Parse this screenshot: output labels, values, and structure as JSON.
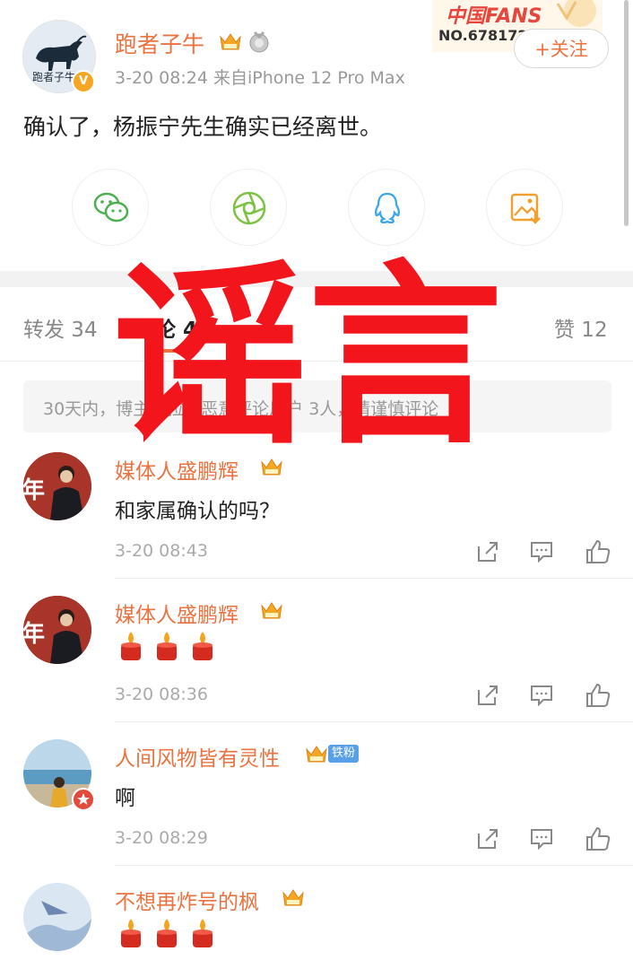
{
  "post": {
    "author": "跑者子牛",
    "avatar_text": "跑者子牛",
    "verified_badge": "V",
    "time_source": "3-20 08:24  来自iPhone 12 Pro Max",
    "text": "确认了，杨振宁先生确实已经离世。",
    "fans_badge_title": "中国FANS",
    "fans_badge_no": "NO.678172",
    "follow_label": "+关注"
  },
  "share_icons": [
    "wechat-icon",
    "moments-icon",
    "qq-icon",
    "save-image-icon"
  ],
  "tabs": {
    "repost": "转发 34",
    "comments": "评论 49",
    "likes": "赞 12"
  },
  "notice": "30天内，博主已拉黑恶意评论用户 3人，请谨慎评论",
  "overlay_text": "谣言",
  "comments": [
    {
      "name": "媒体人盛鹏辉",
      "avatar_text": "年",
      "text": "和家属确认的吗？",
      "time": "3-20 08:43",
      "candles": 0,
      "badge": ""
    },
    {
      "name": "媒体人盛鹏辉",
      "avatar_text": "年",
      "text": "",
      "time": "3-20 08:36",
      "candles": 3,
      "badge": ""
    },
    {
      "name": "人间风物皆有灵性",
      "avatar_text": "",
      "text": "啊",
      "time": "3-20 08:29",
      "candles": 0,
      "badge": "铁粉"
    },
    {
      "name": "不想再炸号的枫",
      "avatar_text": "",
      "text": "",
      "time": "",
      "candles": 3,
      "badge": ""
    }
  ],
  "colors": {
    "accent": "#eb7340",
    "overlay_red": "#f2151c",
    "badge_blue": "#5aa0e8"
  }
}
